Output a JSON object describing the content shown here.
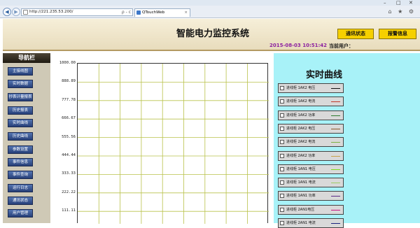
{
  "browser": {
    "url": "http://221.235.53.200/",
    "tab_title": "QTouchWeb",
    "addr_tools": "ρ - c",
    "right_icons": "⌂ ★ ⚙"
  },
  "window_controls": {
    "minimize": "–",
    "maximize": "□",
    "close": "✕"
  },
  "header": {
    "title": "智能电力监控系统",
    "datetime": "2015-08-03 10:51:42",
    "user_label": "当前用户：",
    "btn_comm": "通讯状态",
    "btn_alarm": "报警信息"
  },
  "sidebar": {
    "heading": "导航栏",
    "items": [
      {
        "label": "主接线图"
      },
      {
        "label": "实时数据"
      },
      {
        "label": "抄表计量报表"
      },
      {
        "label": "历史报表"
      },
      {
        "label": "实时曲线"
      },
      {
        "label": "历史曲线"
      },
      {
        "label": "参数设置"
      },
      {
        "label": "事件信息"
      },
      {
        "label": "事件查询"
      },
      {
        "label": "运行日志"
      },
      {
        "label": "通讯状态"
      },
      {
        "label": "用户管理"
      }
    ]
  },
  "chart_data": {
    "type": "line",
    "title": "",
    "xlabel": "",
    "ylabel": "",
    "ylim": [
      0,
      1000
    ],
    "y_ticks": [
      "1000.00",
      "888.89",
      "777.78",
      "666.67",
      "555.56",
      "444.44",
      "333.33",
      "222.22",
      "111.11"
    ],
    "grid": true,
    "series": []
  },
  "realtime": {
    "title": "实时曲线",
    "items": [
      {
        "label": "进线柜 1AK2  电压",
        "color": "#111111"
      },
      {
        "label": "进线柜 1AK2  电流",
        "color": "#c0392b"
      },
      {
        "label": "进线柜 1AK2  功率",
        "color": "#2e7d32"
      },
      {
        "label": "进线柜 2AK2  电压",
        "color": "#8b5a2b"
      },
      {
        "label": "进线柜 2AK2  电流",
        "color": "#7cb342"
      },
      {
        "label": "进线柜 2AK2  功率",
        "color": "#c6a24a"
      },
      {
        "label": "进线柜 1AN1  电压",
        "color": "#7ddc1f"
      },
      {
        "label": "进线柜 1AN1 电流",
        "color": "#9ccc65"
      },
      {
        "label": "进线柜 1AN1  功率",
        "color": "#5b2a86"
      },
      {
        "label": "进线柜 2AN1电压",
        "color": "#c71585"
      },
      {
        "label": "进线柜 2AN1  电流",
        "color": "#1a237e"
      }
    ]
  }
}
